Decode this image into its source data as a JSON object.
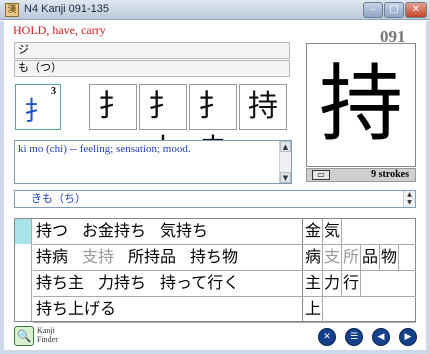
{
  "window": {
    "title": "N4 Kanji 091-135",
    "min_glyph": "–",
    "max_glyph": "□",
    "close_glyph": "✕",
    "app_icon": "漢"
  },
  "kanji": {
    "meaning": "HOLD, have, carry",
    "number": "091",
    "on_reading": "ジ",
    "kun_reading": "も（つ）",
    "big": "持",
    "radical": "扌",
    "radical_number": "3",
    "stroke_sequence": [
      "扌",
      "扌土",
      "扌圭",
      "持"
    ],
    "stroke_count": "9 strokes",
    "print_icon": "print-icon"
  },
  "description": "ki mo (chi) -- feeling; sensation; mood.",
  "selected_word": "きも（ち）",
  "compounds": [
    {
      "words": [
        {
          "t": "持つ",
          "faint": false
        },
        {
          "t": "お金持ち",
          "faint": false
        },
        {
          "t": "気持ち",
          "faint": false
        }
      ],
      "chars": [
        {
          "t": "金",
          "faint": false
        },
        {
          "t": "気",
          "faint": false
        }
      ]
    },
    {
      "words": [
        {
          "t": "持病",
          "faint": false
        },
        {
          "t": "支持",
          "faint": true
        },
        {
          "t": "所持品",
          "faint": false
        },
        {
          "t": "持ち物",
          "faint": false
        }
      ],
      "chars": [
        {
          "t": "病",
          "faint": false
        },
        {
          "t": "支",
          "faint": true
        },
        {
          "t": "所",
          "faint": true
        },
        {
          "t": "品",
          "faint": false
        },
        {
          "t": "物",
          "faint": false
        }
      ]
    },
    {
      "words": [
        {
          "t": "持ち主",
          "faint": false
        },
        {
          "t": "力持ち",
          "faint": false
        },
        {
          "t": "持って行く",
          "faint": false
        }
      ],
      "chars": [
        {
          "t": "主",
          "faint": false
        },
        {
          "t": "力",
          "faint": false
        },
        {
          "t": "行",
          "faint": false
        }
      ]
    },
    {
      "words": [
        {
          "t": "持ち上げる",
          "faint": false
        }
      ],
      "chars": [
        {
          "t": "上",
          "faint": false
        }
      ]
    }
  ],
  "finder": {
    "label_line1": "Kanji",
    "label_line2": "Finder",
    "icon": "🔍"
  },
  "nav": [
    {
      "name": "close-nav-button",
      "glyph": "✕"
    },
    {
      "name": "list-nav-button",
      "glyph": "☰"
    },
    {
      "name": "prev-nav-button",
      "glyph": "◀"
    },
    {
      "name": "next-nav-button",
      "glyph": "▶"
    }
  ]
}
